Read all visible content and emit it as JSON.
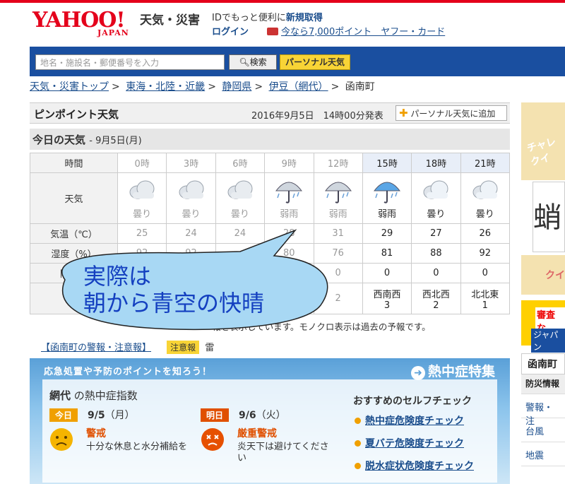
{
  "header": {
    "logo_text": "YAHOO!",
    "logo_sub": "JAPAN",
    "service": "天気・災害",
    "id_text": "IDでもっと便利に",
    "id_link": "新規取得",
    "login": "ログイン",
    "card_promo": "今なら7,000ポイント　ヤフー・カード"
  },
  "search": {
    "placeholder": "地名・施設名・郵便番号を入力",
    "search_button": "検索",
    "personal_button": "パーソナル天気"
  },
  "breadcrumb": [
    "天気・災害トップ",
    "東海・北陸・近畿",
    "静岡県",
    "伊豆（網代）",
    "函南町"
  ],
  "pinpoint": {
    "title": "ピンポイント天気",
    "date": "2016年9月5日　14時00分発表",
    "add_button": "パーソナル天気に追加"
  },
  "today": {
    "title": "今日の天気",
    "date": "- 9月5日(月)"
  },
  "forecast": {
    "row_labels": [
      "時間",
      "天気",
      "気温（℃）",
      "湿度（%）",
      "降水量",
      "風"
    ],
    "hours": [
      "0時",
      "3時",
      "6時",
      "9時",
      "12時",
      "15時",
      "18時",
      "21時"
    ],
    "active": [
      false,
      false,
      false,
      false,
      false,
      true,
      true,
      true
    ],
    "weather": [
      "曇り",
      "曇り",
      "曇り",
      "弱雨",
      "弱雨",
      "弱雨",
      "曇り",
      "曇り"
    ],
    "weather_icons": [
      "cloud-icon",
      "cloud-icon",
      "cloud-icon",
      "umbrella-icon",
      "umbrella-icon",
      "umbrella-icon",
      "cloud-icon",
      "cloud-icon"
    ],
    "temp": [
      "25",
      "24",
      "24",
      "28",
      "31",
      "29",
      "27",
      "26"
    ],
    "humidity": [
      "92",
      "92",
      "",
      "80",
      "76",
      "81",
      "88",
      "92"
    ],
    "precip": [
      "",
      "",
      "",
      "",
      "0",
      "0",
      "0",
      "0"
    ],
    "wind_dir": [
      "",
      "",
      "",
      "",
      "",
      "西南西",
      "西北西",
      "北北東"
    ],
    "wind_speed": [
      "",
      "",
      "",
      "",
      "2",
      "3",
      "2",
      "1"
    ]
  },
  "note": "報を表示しています。モノクロ表示は過去の予報です。",
  "warning": {
    "link": "【函南町の警報・注意報】",
    "badge": "注意報",
    "item": "雷"
  },
  "heat": {
    "header": "応急処置や予防のポイントを知ろう！",
    "feature": "熱中症特集",
    "place": "網代",
    "index_label": "の熱中症指数",
    "today_badge": "今日",
    "today_date": "9/5",
    "today_dow": "（月）",
    "today_level": "警戒",
    "today_desc": "十分な休息と水分補給を",
    "tomorrow_badge": "明日",
    "tomorrow_date": "9/6",
    "tomorrow_dow": "（火）",
    "tomorrow_level": "厳重警戒",
    "tomorrow_desc": "炎天下は避けてください",
    "check_title": "おすすめのセルフチェック",
    "checks": [
      "熱中症危険度チェック",
      "夏バテ危険度チェック",
      "脱水症状危険度チェック"
    ]
  },
  "sidebar": {
    "ad1": "チャレ クイ",
    "ad2": "蛸",
    "ad3": "クイ",
    "ad4a": "審査な",
    "ad4b": "ジャパン",
    "nav_head": "函南町",
    "nav_sub": "防災情報",
    "nav_items": [
      "警報・注",
      "台風",
      "地震"
    ]
  },
  "annotation": {
    "line1": "実際は",
    "line2": "朝から青空の快晴"
  },
  "colors": {
    "brand_red": "#e4001b",
    "search_blue": "#1a4fa0",
    "link_blue": "#1a4d8c",
    "bubble_fill": "#a8d8f4",
    "bubble_text": "#1440c0"
  }
}
